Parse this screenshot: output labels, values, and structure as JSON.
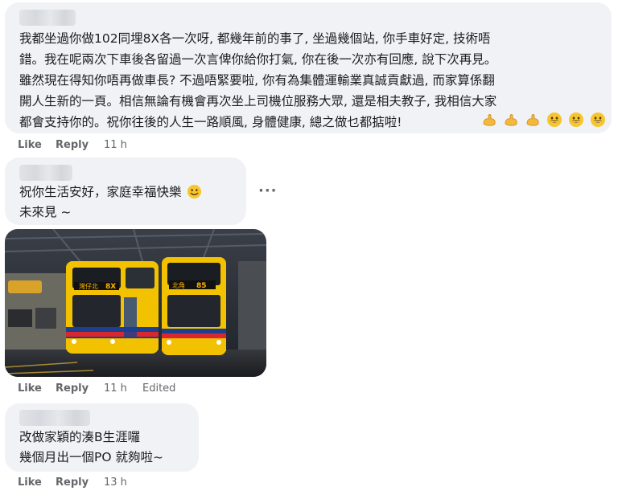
{
  "comments": [
    {
      "text": "我都坐過你做102同埋8X各一次呀, 都幾年前的事了, 坐過幾個站, 你手車好定, 技術唔\n錯。我在呢兩次下車後各留過一次言俾你給你打氣, 你在後一次亦有回應, 說下次再見。\n雖然現在得知你唔再做車長? 不過唔緊要啦, 你有為集體運輸業真誠貢獻過, 而家算係翻\n開人生新的一頁。相信無論有機會再次坐上司機位服務大眾, 還是相夫教子, 我相信大家\n都會支持你的。祝你往後的人生一路順風, 身體健康, 總之做乜都掂啦!",
      "emoji": [
        "flexed-biceps",
        "flexed-biceps",
        "flexed-biceps",
        "grinning-face",
        "grinning-face",
        "grinning-face"
      ],
      "like_label": "Like",
      "reply_label": "Reply",
      "time": "11 h"
    },
    {
      "text": "祝你生活安好，家庭幸福快樂",
      "text_line2": "未來見 ~",
      "emoji": [
        "smiling-face"
      ],
      "more_label": "···",
      "like_label": "Like",
      "reply_label": "Reply",
      "time": "11 h",
      "edited": "Edited",
      "photo": {
        "bus_left_route": "8X",
        "bus_right_route": "85",
        "bus_left_dest": "灣仔北",
        "bus_right_dest": "北角",
        "colors": {
          "yellow": "#f2c200",
          "red": "#d9272e",
          "blue": "#1d3f8f"
        }
      }
    },
    {
      "text": "改做家穎的湊B生涯囉",
      "text_line2": "幾個月出一個PO 就夠啦~",
      "like_label": "Like",
      "reply_label": "Reply",
      "time": "13 h"
    }
  ]
}
